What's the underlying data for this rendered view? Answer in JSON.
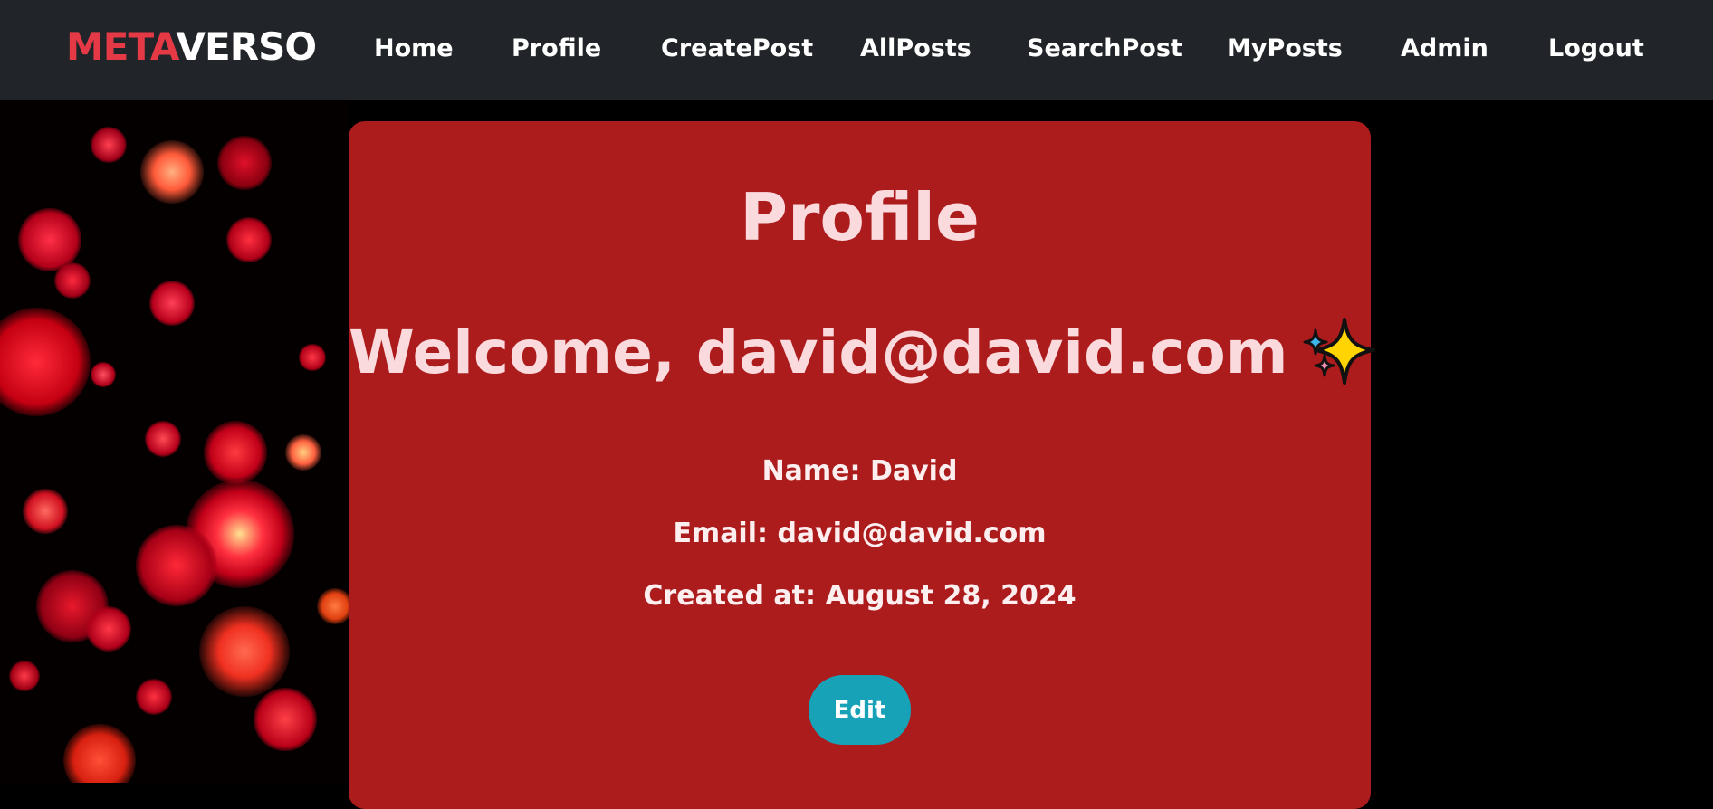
{
  "brand": {
    "part1": "META",
    "part2": "VERSO"
  },
  "nav": {
    "items": [
      {
        "label": "Home"
      },
      {
        "label": "Profile"
      },
      {
        "label": "CreatePost"
      },
      {
        "label": "AllPosts"
      },
      {
        "label": "SearchPost"
      },
      {
        "label": "MyPosts"
      },
      {
        "label": "Admin"
      },
      {
        "label": "Logout"
      }
    ]
  },
  "profile": {
    "title": "Profile",
    "welcome": "Welcome, david@david.com",
    "welcome_icon": "sparkles-icon",
    "name_line": "Name: David",
    "email_line": "Email: david@david.com",
    "created_line": "Created at: August 28, 2024",
    "edit_label": "Edit"
  },
  "colors": {
    "navbar": "#212529",
    "brand_accent": "#e63946",
    "card": "#ad1c1d",
    "title_text": "#fadadd",
    "button": "#17a2b8"
  }
}
